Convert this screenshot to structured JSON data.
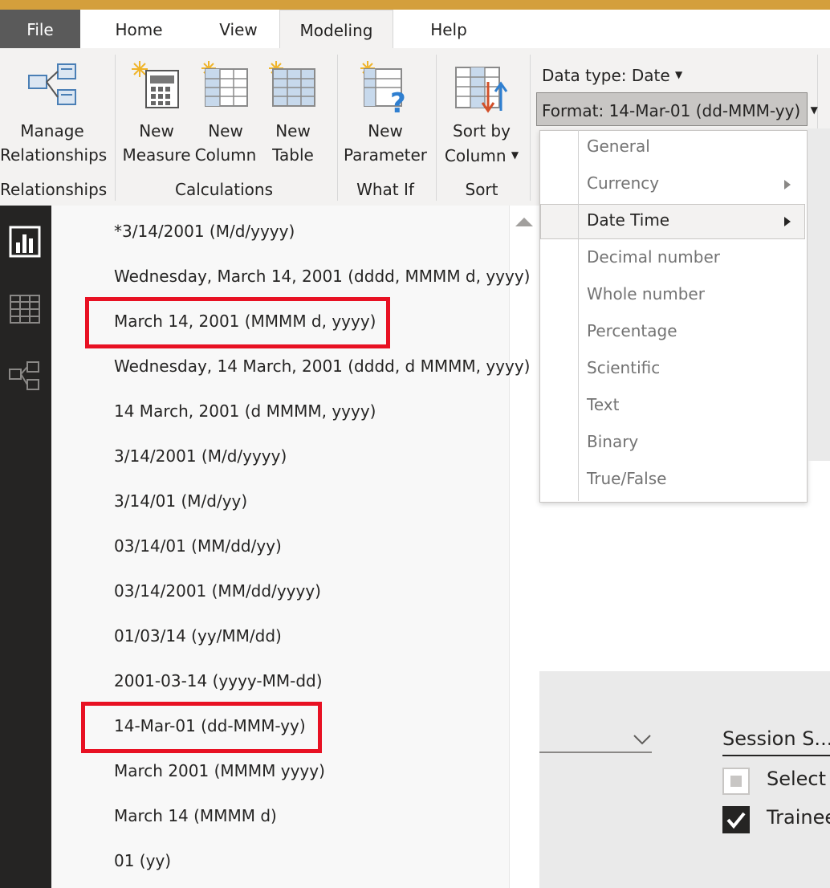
{
  "tabs": {
    "file": "File",
    "home": "Home",
    "view": "View",
    "modeling": "Modeling",
    "help": "Help"
  },
  "ribbon": {
    "manage_relationships": [
      "Manage",
      "Relationships"
    ],
    "new_measure": [
      "New",
      "Measure"
    ],
    "new_column": [
      "New",
      "Column"
    ],
    "new_table": [
      "New",
      "Table"
    ],
    "new_parameter": [
      "New",
      "Parameter"
    ],
    "sort_by_column": [
      "Sort by",
      "Column"
    ],
    "groups": {
      "relationships": "Relationships",
      "calculations": "Calculations",
      "what_if": "What If",
      "sort": "Sort"
    }
  },
  "properties": {
    "data_type": "Data type: Date",
    "format": "Format: 14-Mar-01 (dd-MMM-yy)"
  },
  "type_menu": [
    {
      "label": "General",
      "submenu": false
    },
    {
      "label": "Currency",
      "submenu": true
    },
    {
      "label": "Date Time",
      "submenu": true,
      "selected": true
    },
    {
      "label": "Decimal number",
      "submenu": false
    },
    {
      "label": "Whole number",
      "submenu": false
    },
    {
      "label": "Percentage",
      "submenu": false
    },
    {
      "label": "Scientific",
      "submenu": false
    },
    {
      "label": "Text",
      "submenu": false
    },
    {
      "label": "Binary",
      "submenu": false
    },
    {
      "label": "True/False",
      "submenu": false
    }
  ],
  "formats": [
    {
      "label": "*3/14/2001 (M/d/yyyy)",
      "highlighted": false
    },
    {
      "label": "Wednesday, March 14, 2001 (dddd, MMMM d, yyyy)",
      "highlighted": false
    },
    {
      "label": "March 14, 2001 (MMMM d, yyyy)",
      "highlighted": true
    },
    {
      "label": "Wednesday, 14 March, 2001 (dddd, d MMMM, yyyy)",
      "highlighted": false
    },
    {
      "label": "14 March, 2001 (d MMMM, yyyy)",
      "highlighted": false
    },
    {
      "label": "3/14/2001 (M/d/yyyy)",
      "highlighted": false
    },
    {
      "label": "3/14/01 (M/d/yy)",
      "highlighted": false
    },
    {
      "label": "03/14/01 (MM/dd/yy)",
      "highlighted": false
    },
    {
      "label": "03/14/2001 (MM/dd/yyyy)",
      "highlighted": false
    },
    {
      "label": "01/03/14 (yy/MM/dd)",
      "highlighted": false
    },
    {
      "label": "2001-03-14 (yyyy-MM-dd)",
      "highlighted": false
    },
    {
      "label": "14-Mar-01 (dd-MMM-yy)",
      "highlighted": true
    },
    {
      "label": "March 2001 (MMMM yyyy)",
      "highlighted": false
    },
    {
      "label": "March 14 (MMMM d)",
      "highlighted": false
    },
    {
      "label": "01 (yy)",
      "highlighted": false
    }
  ],
  "slicer": {
    "title": "Session S...",
    "items": [
      {
        "label": "Select",
        "checked": false
      },
      {
        "label": "Trainee",
        "checked": true
      }
    ]
  },
  "colors": {
    "title_bar": "#d49f3c",
    "highlight_box": "#e81123",
    "nav_bg": "#252423",
    "ribbon_bg": "#f3f2f1"
  }
}
